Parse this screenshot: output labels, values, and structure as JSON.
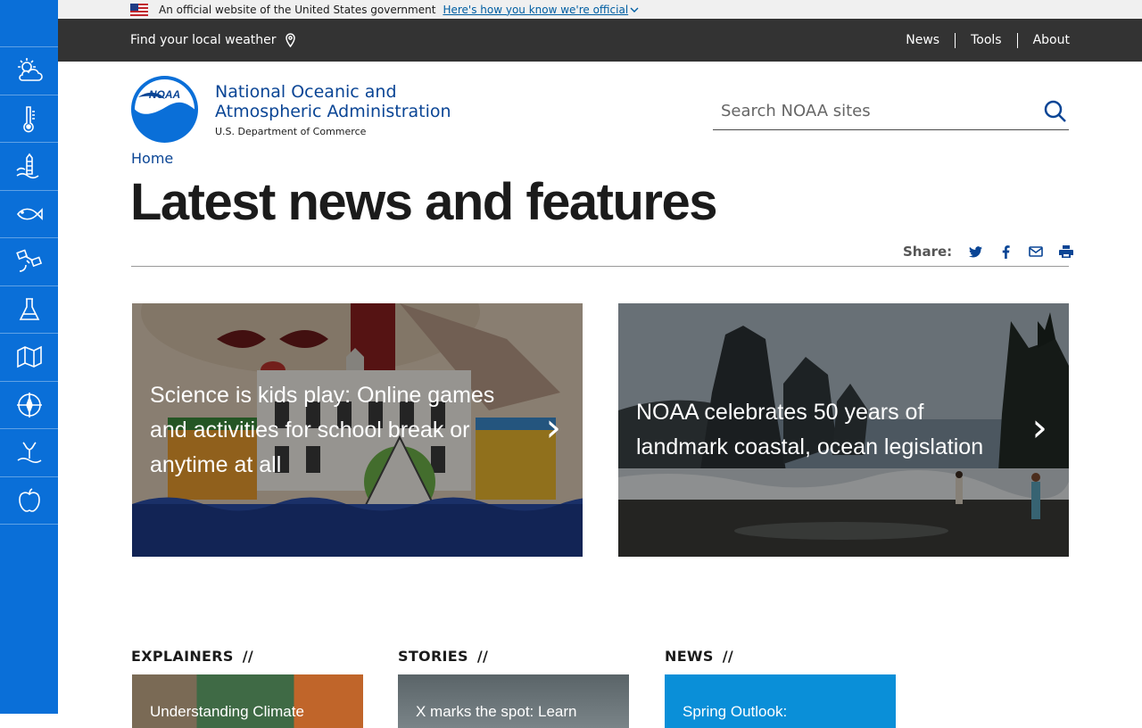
{
  "gov_banner": {
    "text": "An official website of the United States government",
    "link": "Here's how you know we're official"
  },
  "utility": {
    "weather": "Find your local weather",
    "nav": [
      "News",
      "Tools",
      "About"
    ]
  },
  "header": {
    "logo_text": "NOAA",
    "org_line1": "National Oceanic and",
    "org_line2": "Atmospheric Administration",
    "dept": "U.S. Department of Commerce",
    "search_placeholder": "Search NOAA sites"
  },
  "breadcrumb": "Home",
  "page_title": "Latest news and features",
  "share_label": "Share:",
  "features": [
    {
      "title": "Science is kids play: Online games and activities for school break or anytime at all",
      "arrow": "›"
    },
    {
      "title": "NOAA celebrates 50 years of landmark coastal, ocean legislation",
      "arrow": "›"
    }
  ],
  "sections": [
    {
      "label": "EXPLAINERS",
      "slash": "//",
      "teaser": "Understanding Climate"
    },
    {
      "label": "STORIES",
      "slash": "//",
      "teaser": "X marks the spot: Learn"
    },
    {
      "label": "NEWS",
      "slash": "//",
      "teaser": "Spring Outlook:"
    }
  ],
  "rail_icons": [
    "weather-icon",
    "climate-icon",
    "coast-icon",
    "fisheries-icon",
    "satellite-icon",
    "research-icon",
    "charting-icon",
    "compass-icon",
    "ocean-icon",
    "education-icon"
  ],
  "colors": {
    "rail": "#0a6fd8",
    "utility_bar": "#333333",
    "link": "#0a4595",
    "news_teaser": "#0a8fd8"
  }
}
